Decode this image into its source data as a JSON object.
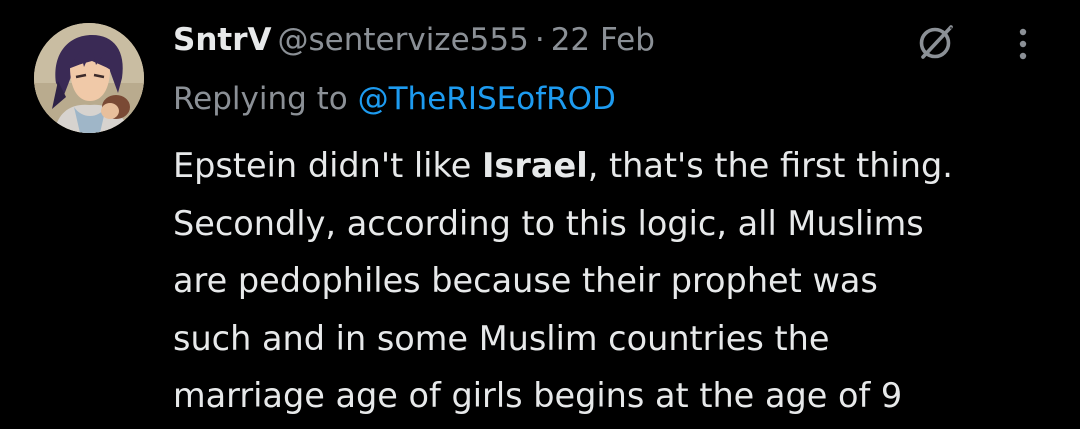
{
  "tweet": {
    "display_name": "SntrV",
    "handle": "@sentervize555",
    "separator": "·",
    "timestamp": "22 Feb",
    "reply_prefix": "Replying to ",
    "reply_mention": "@TheRISEofROD",
    "body": {
      "line1_before": "Epstein didn't like ",
      "line1_bold": "Israel",
      "line1_after": ", that's the first thing.",
      "line2": "Secondly, according to this logic, all Muslims",
      "line3": "are pedophiles because their prophet was",
      "line4": "such and in some Muslim countries the",
      "line5": "marriage age of girls begins at the age of 9"
    }
  },
  "icons": {
    "avatar": "avatar-anime-portrait",
    "grok": "grok-icon",
    "more": "more-options-icon"
  },
  "colors": {
    "background": "#000000",
    "text_primary": "#e7e9ea",
    "text_secondary": "#8b9096",
    "link": "#1d9bf0"
  }
}
